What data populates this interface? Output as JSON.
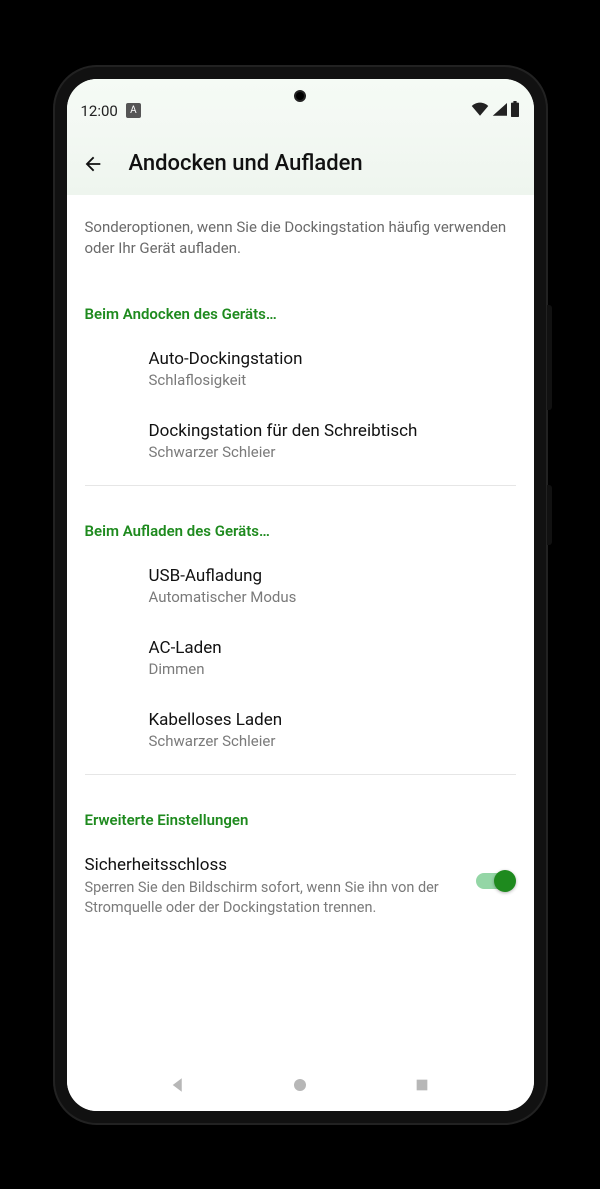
{
  "statusbar": {
    "time": "12:00"
  },
  "appbar": {
    "title": "Andocken und Aufladen"
  },
  "subtitle": "Sonderoptionen, wenn Sie die Dockingstation häufig verwenden oder Ihr Gerät aufladen.",
  "sections": [
    {
      "header": "Beim Andocken des Geräts…",
      "items": [
        {
          "title": "Auto-Dockingstation",
          "sub": "Schlaflosigkeit"
        },
        {
          "title": "Dockingstation für den Schreibtisch",
          "sub": "Schwarzer Schleier"
        }
      ]
    },
    {
      "header": "Beim Aufladen des Geräts…",
      "items": [
        {
          "title": "USB-Aufladung",
          "sub": "Automatischer Modus"
        },
        {
          "title": "AC-Laden",
          "sub": "Dimmen"
        },
        {
          "title": "Kabelloses Laden",
          "sub": "Schwarzer Schleier"
        }
      ]
    }
  ],
  "advanced": {
    "header": "Erweiterte Einstellungen",
    "switch": {
      "title": "Sicherheitsschloss",
      "sub": "Sperren Sie den Bildschirm sofort, wenn Sie ihn von der Stromquelle oder der Dockingstation trennen.",
      "on": true
    }
  }
}
